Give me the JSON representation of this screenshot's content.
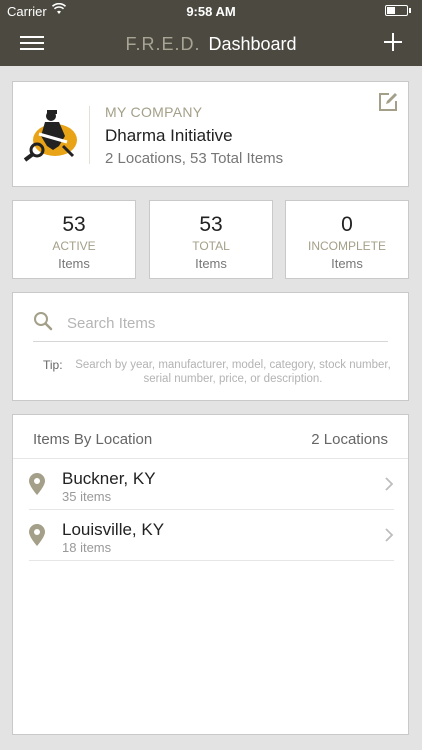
{
  "status": {
    "carrier": "Carrier",
    "time": "9:58 AM"
  },
  "nav": {
    "brand": "F.R.E.D.",
    "page_title": "Dashboard",
    "menu_icon": "hamburger-menu-icon",
    "add_icon": "plus-icon"
  },
  "company": {
    "label": "MY COMPANY",
    "name": "Dharma Initiative",
    "summary": "2 Locations, 53 Total Items",
    "edit_icon": "edit-icon"
  },
  "stats": [
    {
      "value": "53",
      "label": "ACTIVE",
      "sub": "Items"
    },
    {
      "value": "53",
      "label": "TOTAL",
      "sub": "Items"
    },
    {
      "value": "0",
      "label": "INCOMPLETE",
      "sub": "Items"
    }
  ],
  "search": {
    "placeholder": "Search Items",
    "tip_label": "Tip:",
    "tip_text": "Search by year, manufacturer, model, category, stock number, serial number, price, or description."
  },
  "locations": {
    "title": "Items By Location",
    "count": "2 Locations",
    "items": [
      {
        "name": "Buckner, KY",
        "items": "35 items"
      },
      {
        "name": "Louisville, KY",
        "items": "18 items"
      }
    ]
  },
  "colors": {
    "navbar": "#4c4a40",
    "accent": "#a39f88",
    "background": "#e3e3e3"
  }
}
